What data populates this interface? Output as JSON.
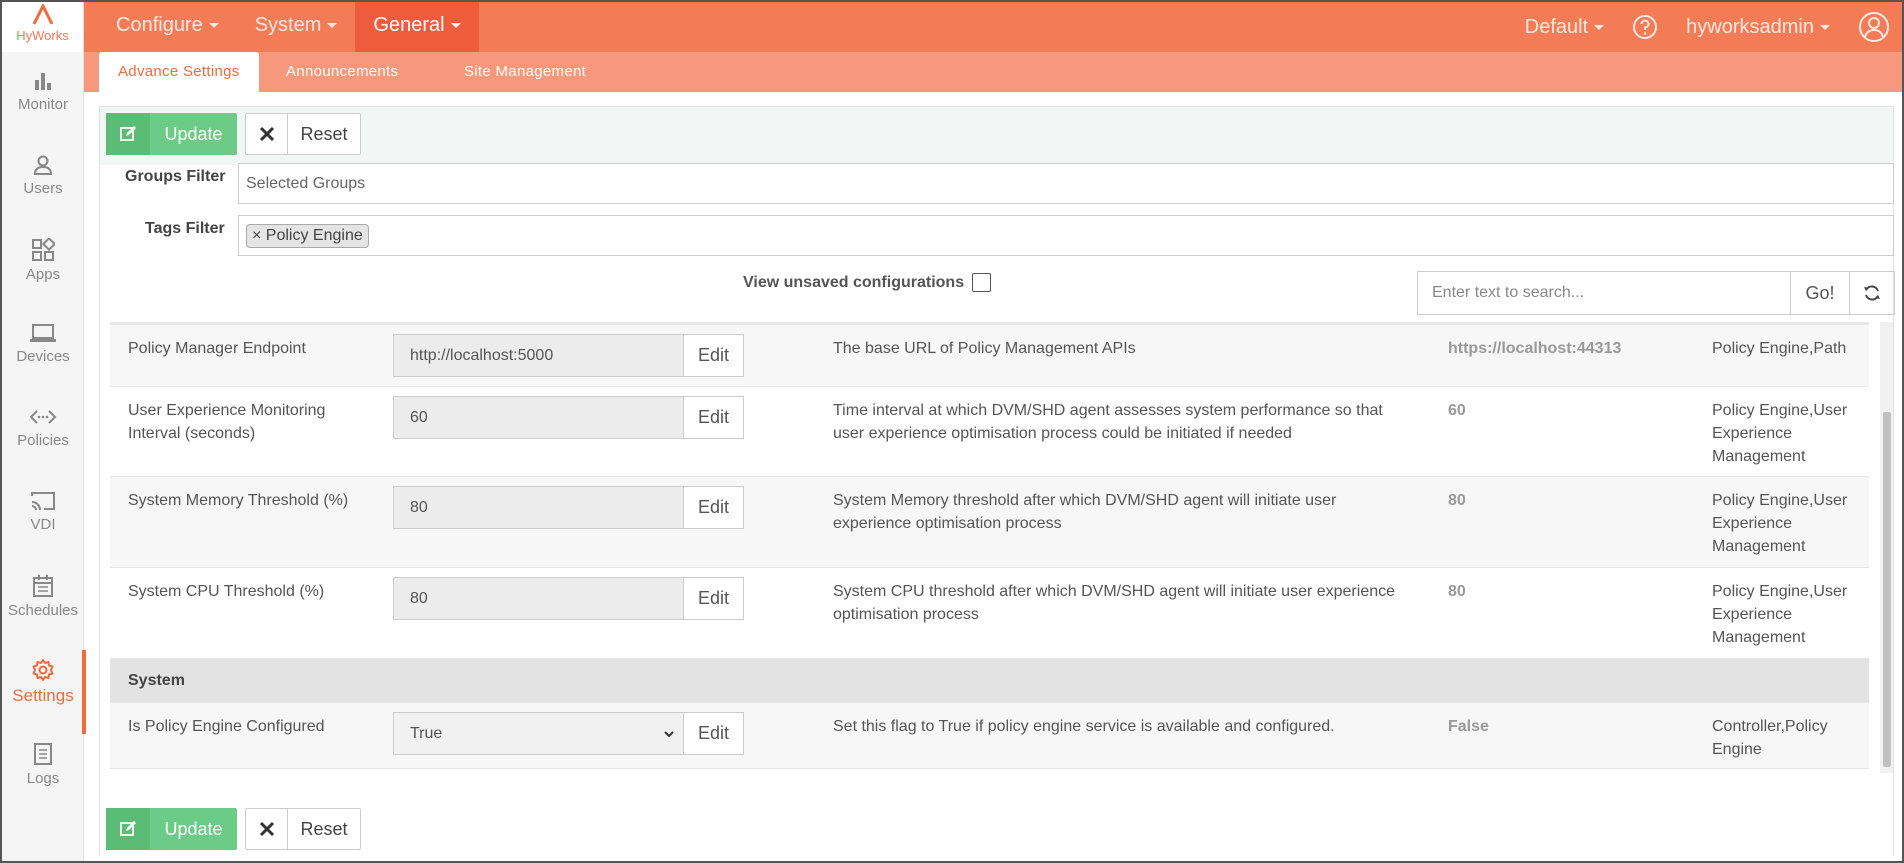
{
  "app": {
    "logo_text": "HyWorks"
  },
  "sidebar": {
    "items": [
      {
        "label": "Monitor",
        "icon": "bar-chart-icon"
      },
      {
        "label": "Users",
        "icon": "user-icon"
      },
      {
        "label": "Apps",
        "icon": "apps-grid-icon"
      },
      {
        "label": "Devices",
        "icon": "laptop-icon"
      },
      {
        "label": "Policies",
        "icon": "code-arrows-icon"
      },
      {
        "label": "VDI",
        "icon": "cast-icon"
      },
      {
        "label": "Schedules",
        "icon": "calendar-icon"
      },
      {
        "label": "Settings",
        "icon": "gear-icon",
        "active": true
      },
      {
        "label": "Logs",
        "icon": "log-icon"
      }
    ]
  },
  "topnav": {
    "items": [
      {
        "label": "Configure"
      },
      {
        "label": "System"
      },
      {
        "label": "General",
        "active": true
      }
    ],
    "tenant": "Default",
    "user": "hyworksadmin"
  },
  "subtabs": [
    {
      "label": "Advance Settings",
      "active": true
    },
    {
      "label": "Announcements"
    },
    {
      "label": "Site Management"
    }
  ],
  "toolbar": {
    "update_label": "Update",
    "reset_label": "Reset"
  },
  "filters": {
    "groups_label": "Groups Filter",
    "groups_placeholder": "Selected Groups",
    "tags_label": "Tags Filter",
    "tag_remove": "×",
    "tags": [
      "Policy Engine"
    ]
  },
  "unsaved_label": "View unsaved configurations",
  "search": {
    "placeholder": "Enter text to search...",
    "go_label": "Go!"
  },
  "settings": [
    {
      "name": "Policy Manager Endpoint",
      "value": "http://localhost:5000",
      "edit": "Edit",
      "description": "The base URL of Policy Management APIs",
      "default": "https://localhost:44313",
      "tags": "Policy Engine,Path"
    },
    {
      "name": "User Experience Monitoring Interval (seconds)",
      "value": "60",
      "edit": "Edit",
      "description": "Time interval at which DVM/SHD agent assesses system performance so that user experience optimisation process could be initiated if needed",
      "default": "60",
      "tags": "Policy Engine,User Experience Management"
    },
    {
      "name": "System Memory Threshold (%)",
      "value": "80",
      "edit": "Edit",
      "description": "System Memory threshold after which DVM/SHD agent will initiate user experience optimisation process",
      "default": "80",
      "tags": "Policy Engine,User Experience Management"
    },
    {
      "name": "System CPU Threshold (%)",
      "value": "80",
      "edit": "Edit",
      "description": "System CPU threshold after which DVM/SHD agent will initiate user experience optimisation process",
      "default": "80",
      "tags": "Policy Engine,User Experience Management"
    }
  ],
  "group": {
    "label": "System"
  },
  "system_settings": [
    {
      "name": "Is Policy Engine Configured",
      "value": "True",
      "edit": "Edit",
      "description": "Set this flag to True if policy engine service is available and configured.",
      "default": "False",
      "tags": "Controller,Policy Engine"
    }
  ]
}
